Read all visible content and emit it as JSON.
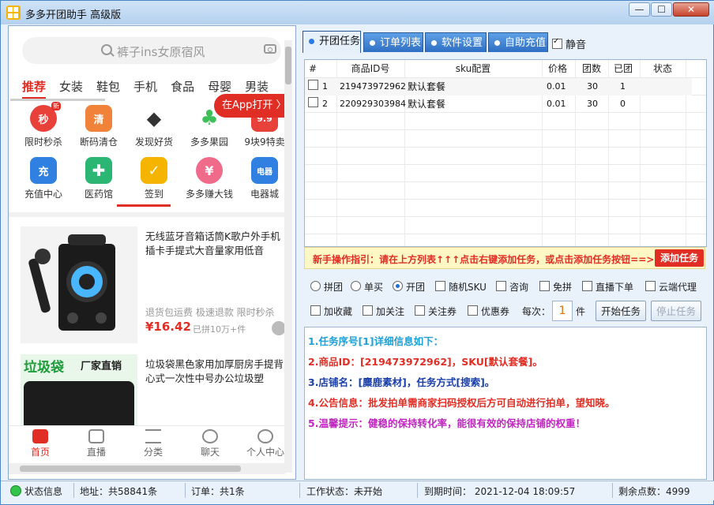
{
  "window": {
    "title": "多多开团助手 高级版",
    "min": "—",
    "max": "☐",
    "close": "✕"
  },
  "phone": {
    "search_placeholder": "裤子ins女原宿风",
    "categories": [
      "推荐",
      "女装",
      "鞋包",
      "手机",
      "食品",
      "母婴",
      "男装"
    ],
    "open_in_app": "在App打开 〉",
    "icons": [
      {
        "label": "限时秒杀",
        "glyph": "秒",
        "color": "#e8413a",
        "badge": "新"
      },
      {
        "label": "断码清仓",
        "glyph": "清",
        "color": "#f0823a"
      },
      {
        "label": "发现好货",
        "glyph": "◆",
        "color": "#333333"
      },
      {
        "label": "多多果园",
        "glyph": "♣",
        "color": "#3fbf5a"
      },
      {
        "label": "9块9特卖",
        "glyph": "9.9",
        "color": "#e8413a"
      },
      {
        "label": "充值中心",
        "glyph": "充",
        "color": "#2f80e0"
      },
      {
        "label": "医药馆",
        "glyph": "✚",
        "color": "#2bb673"
      },
      {
        "label": "签到",
        "glyph": "✓",
        "color": "#f5b400"
      },
      {
        "label": "多多赚大钱",
        "glyph": "¥",
        "color": "#f06a8a"
      },
      {
        "label": "电器城",
        "glyph": "电器",
        "color": "#2f80e0"
      }
    ],
    "products": [
      {
        "name": "无线蓝牙音箱话筒K歌户外手机插卡手提式大音量家用低音",
        "tags": "退货包运费  极速退款  限时秒杀",
        "price": "¥16.42",
        "sold": "已拼10万+件"
      },
      {
        "name": "垃圾袋黑色家用加厚厨房手提背心式一次性中号办公垃圾塑",
        "img_title": "垃圾袋",
        "img_sub": "厂家直销"
      }
    ],
    "tabbar": [
      "首页",
      "直播",
      "分类",
      "聊天",
      "个人中心"
    ]
  },
  "tabs": [
    "开团任务",
    "订单列表",
    "软件设置",
    "自助充值"
  ],
  "mute_label": "静音",
  "table": {
    "headers": [
      "#",
      "商品ID号",
      "sku配置",
      "价格",
      "团数",
      "已团",
      "状态"
    ],
    "rows": [
      {
        "no": "1",
        "id": "219473972962",
        "sku": "默认套餐",
        "price": "0.01",
        "groups": "30",
        "done": "1",
        "status": ""
      },
      {
        "no": "2",
        "id": "220929303984",
        "sku": "默认套餐",
        "price": "0.01",
        "groups": "30",
        "done": "0",
        "status": ""
      }
    ]
  },
  "guide": {
    "text": "新手操作指引：请在上方列表↑↑↑点击右键添加任务，或点击添加任务按钮==>>",
    "add_button": "添加任务"
  },
  "options": {
    "radios": [
      "拼团",
      "单买",
      "开团"
    ],
    "checks_row1": [
      "随机SKU",
      "咨询",
      "免拼",
      "直播下单",
      "云端代理"
    ],
    "checks_row2": [
      "加收藏",
      "加关注",
      "关注券",
      "优惠券"
    ],
    "each_label": "每次：",
    "each_value": "1",
    "unit": "件",
    "start": "开始任务",
    "stop": "停止任务"
  },
  "info": [
    {
      "text": "1.任务序号[1]详细信息如下：",
      "color": "#1ea0d8"
    },
    {
      "text": "2.商品ID：[219473972962]，SKU[默认套餐]。",
      "color": "#e02e24"
    },
    {
      "text": "3.店铺名：[麋鹿素材]，任务方式[搜索]。",
      "color": "#1a3fa8"
    },
    {
      "text": "4.公告信息：批发拍单需商家扫码授权后方可自动进行拍单，望知晓。",
      "color": "#e02e24"
    },
    {
      "text": "5.温馨提示：健稳的保持转化率，能很有效的保持店铺的权重！",
      "color": "#c026c0"
    }
  ],
  "status": {
    "state": "状态信息",
    "address": "地址：共58841条",
    "orders": "订单：共1条",
    "work": "工作状态：未开始",
    "expire": "到期时间：  2021-12-04 18:09:57",
    "points": "剩余点数：4999"
  }
}
